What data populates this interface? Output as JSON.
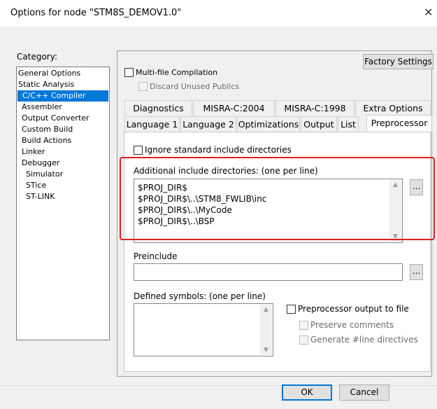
{
  "window": {
    "title": "Options for node \"STM8S_DEMOV1.0\"",
    "close_glyph": "✕"
  },
  "category": {
    "label": "Category:",
    "items": [
      {
        "label": "General Options"
      },
      {
        "label": "Static Analysis"
      },
      {
        "label": "C/C++ Compiler",
        "selected": true
      },
      {
        "label": "Assembler"
      },
      {
        "label": "Output Converter"
      },
      {
        "label": "Custom Build"
      },
      {
        "label": "Build Actions"
      },
      {
        "label": "Linker"
      },
      {
        "label": "Debugger"
      },
      {
        "label": "Simulator"
      },
      {
        "label": "STice"
      },
      {
        "label": "ST-LINK"
      }
    ]
  },
  "factory_settings_label": "Factory Settings",
  "multifile": {
    "label": "Multi-file Compilation",
    "checked": false
  },
  "discard": {
    "label": "Discard Unused Publics",
    "checked": false,
    "disabled": true
  },
  "tabs_row1": [
    "Diagnostics",
    "MISRA-C:2004",
    "MISRA-C:1998",
    "Extra Options"
  ],
  "tabs_row2": [
    "Language 1",
    "Language 2",
    "Optimizations",
    "Output",
    "List",
    "Preprocessor"
  ],
  "active_tab": "Preprocessor",
  "preprocessor": {
    "ignore_std_label": "Ignore standard include directories",
    "ignore_std_checked": false,
    "include_dirs_label": "Additional include directories: (one per line)",
    "include_dirs": [
      "$PROJ_DIR$",
      "$PROJ_DIR$\\..\\STM8_FWLIB\\inc",
      "$PROJ_DIR$\\..\\MyCode",
      "$PROJ_DIR$\\..\\BSP"
    ],
    "browse_label": "...",
    "preinclude_label": "Preinclude",
    "preinclude_value": "",
    "defined_symbols_label": "Defined symbols: (one per line)",
    "defined_symbols": [],
    "output_to_file_label": "Preprocessor output to file",
    "output_to_file_checked": false,
    "preserve_comments_label": "Preserve comments",
    "generate_line_label": "Generate #line directives"
  },
  "ok_label": "OK",
  "cancel_label": "Cancel",
  "colors": {
    "accent": "#0078d7",
    "highlight_box": "#e0201b"
  }
}
